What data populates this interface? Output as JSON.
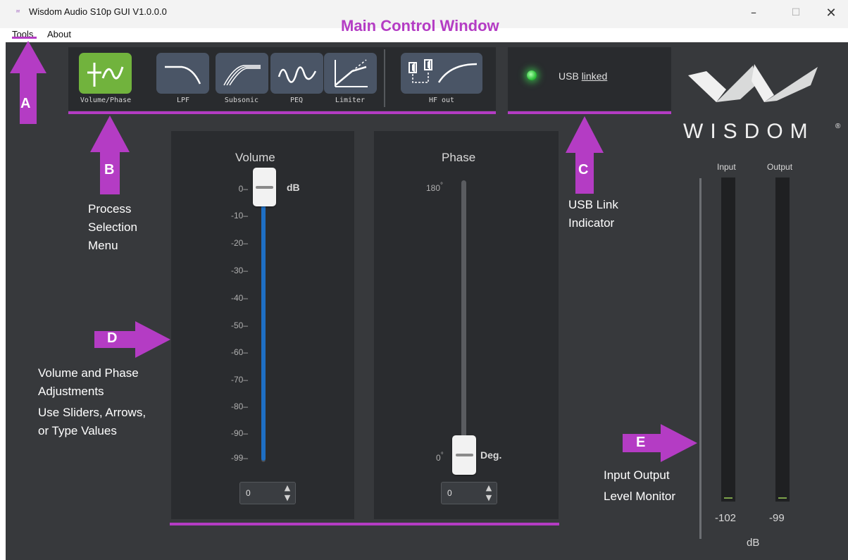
{
  "window": {
    "title": "Wisdom Audio S10p GUI V1.0.0.0",
    "icon_glyph": "ᵡᵡ",
    "minimize_glyph": "–",
    "maximize_glyph": "☐",
    "close_glyph": "✕"
  },
  "menu": {
    "tools_label": "Tools",
    "about_label": "About"
  },
  "annotation_title": "Main Control Window",
  "process_menu": {
    "items": [
      {
        "label": "Volume/Phase",
        "icon": "volume-phase-icon",
        "active": true
      },
      {
        "label": "LPF",
        "icon": "lpf-icon",
        "active": false
      },
      {
        "label": "Subsonic",
        "icon": "subsonic-icon",
        "active": false
      },
      {
        "label": "PEQ",
        "icon": "peq-icon",
        "active": false
      },
      {
        "label": "Limiter",
        "icon": "limiter-icon",
        "active": false
      },
      {
        "label": "HF out",
        "icon": "hf-out-icon",
        "active": false
      }
    ],
    "active_color": "#71b33d",
    "inactive_color": "#4a5566"
  },
  "usb": {
    "prefix": "USB",
    "status": "linked",
    "led_color": "#2fbf3b"
  },
  "logo": {
    "text": "WISDOM",
    "registered_mark": "®"
  },
  "volume": {
    "title": "Volume",
    "unit": "dB",
    "ticks": [
      "0–",
      "-10–",
      "-20–",
      "-30–",
      "-40–",
      "-50–",
      "-60–",
      "-70–",
      "-80–",
      "-90–",
      "-99–"
    ],
    "value": "0",
    "fill_color": "#1e6fc4"
  },
  "phase": {
    "title": "Phase",
    "unit": "Deg.",
    "max_label": "180",
    "min_label": "0",
    "degree_mark": "°",
    "value": "0"
  },
  "spin": {
    "up_glyph": "▲",
    "down_glyph": "▼"
  },
  "meters": {
    "input_label": "Input",
    "output_label": "Output",
    "input_value": "-102",
    "output_value": "-99",
    "unit": "dB"
  },
  "annotations": {
    "accent_color": "#b43cc4",
    "A": {
      "letter": "A"
    },
    "B": {
      "letter": "B",
      "lines": [
        "Process",
        "Selection",
        "Menu"
      ]
    },
    "C": {
      "letter": "C",
      "lines": [
        "USB Link",
        "Indicator"
      ]
    },
    "D": {
      "letter": "D",
      "lines": [
        "Volume and Phase",
        "Adjustments",
        "Use Sliders, Arrows,",
        "or Type Values"
      ]
    },
    "E": {
      "letter": "E",
      "lines": [
        "Input Output",
        "Level Monitor"
      ]
    }
  }
}
